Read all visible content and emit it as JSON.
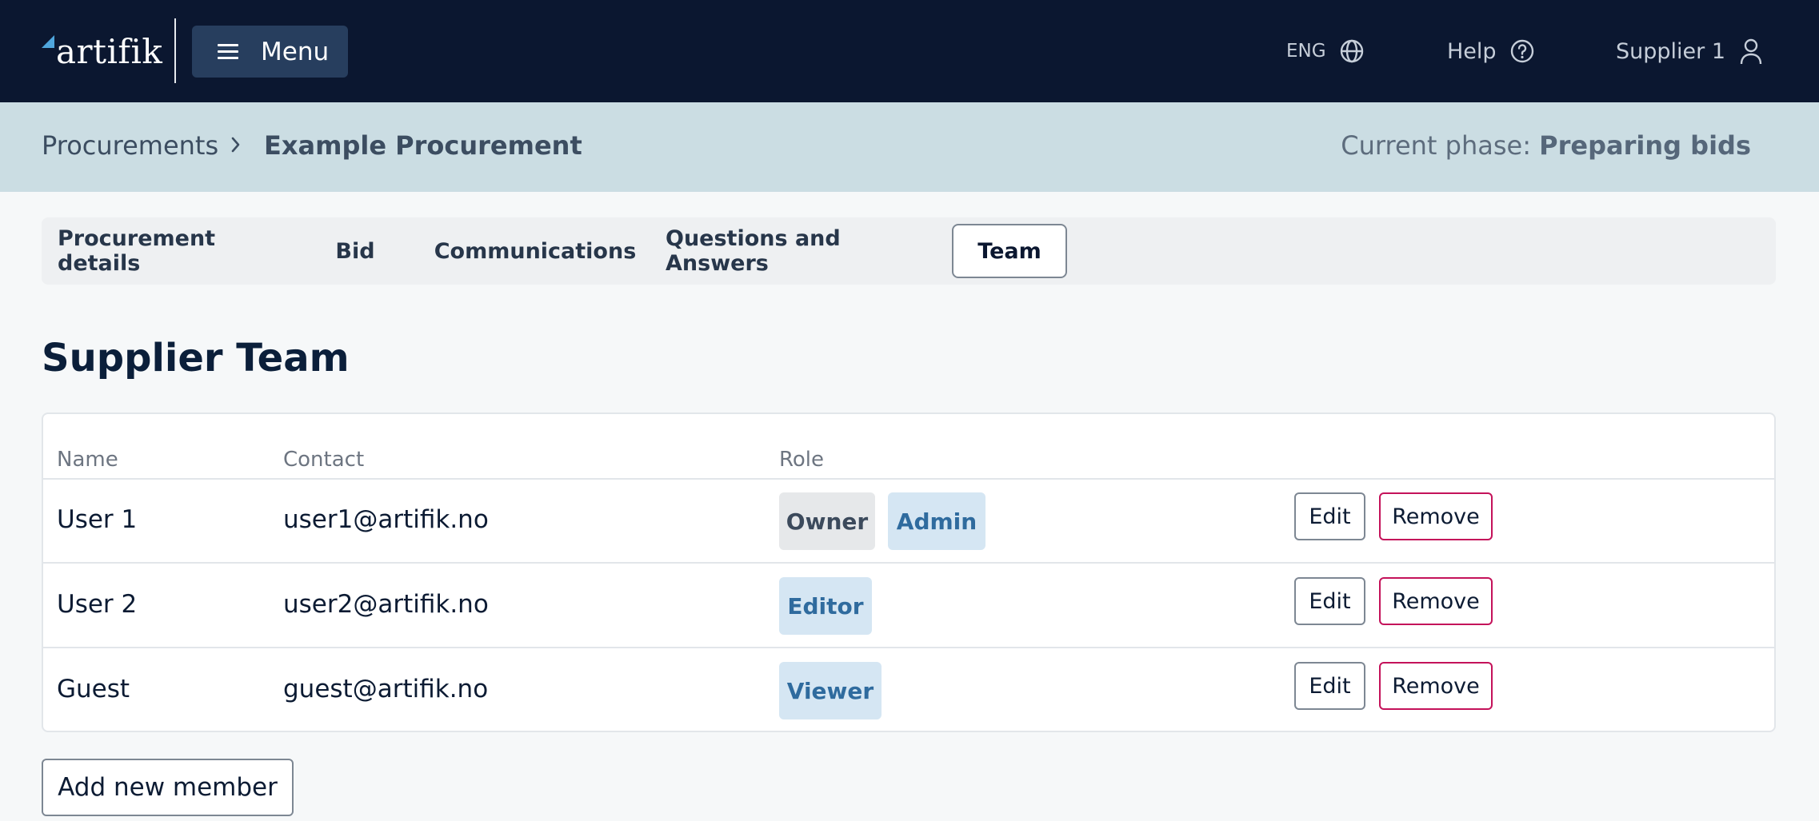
{
  "header": {
    "logo_text": "artifik",
    "menu_label": "Menu",
    "language": "ENG",
    "help_label": "Help",
    "user_label": "Supplier 1"
  },
  "breadcrumb": {
    "parent": "Procurements",
    "current": "Example Procurement",
    "phase_label": "Current phase:",
    "phase_value": "Preparing bids"
  },
  "tabs": [
    {
      "label": "Procurement details",
      "active": false
    },
    {
      "label": "Bid",
      "active": false
    },
    {
      "label": "Communications",
      "active": false
    },
    {
      "label": "Questions and Answers",
      "active": false
    },
    {
      "label": "Team",
      "active": true
    }
  ],
  "section": {
    "title": "Supplier Team"
  },
  "table": {
    "columns": [
      "Name",
      "Contact",
      "Role"
    ],
    "rows": [
      {
        "name": "User 1",
        "contact": "user1@artifik.no",
        "roles": [
          "Owner",
          "Admin"
        ]
      },
      {
        "name": "User 2",
        "contact": "user2@artifik.no",
        "roles": [
          "Editor"
        ]
      },
      {
        "name": "Guest",
        "contact": "guest@artifik.no",
        "roles": [
          "Viewer"
        ]
      }
    ],
    "edit_label": "Edit",
    "remove_label": "Remove"
  },
  "add_member_label": "Add new member",
  "colors": {
    "topbar": "#0b1730",
    "crumbbar": "#cbdde3",
    "accent_blue": "#2f6b9e",
    "remove_border": "#c4125a"
  }
}
